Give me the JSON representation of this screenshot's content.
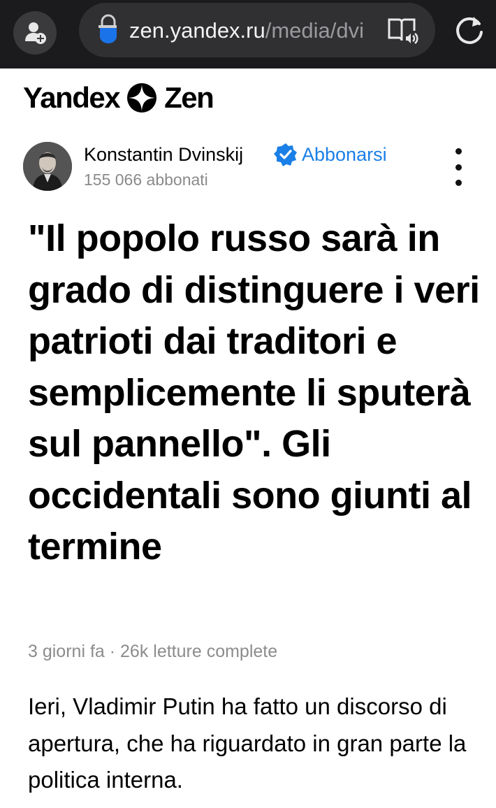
{
  "browser": {
    "url_domain": "zen.yandex.ru",
    "url_path": "/media/dvi",
    "colors": {
      "bar": "#1b1b1d",
      "pill": "#303033",
      "lock_blue": "#1a73e8"
    },
    "icons": [
      "incognito-add-icon",
      "lock-icon",
      "reader-mode-icon",
      "reload-icon"
    ]
  },
  "logo": {
    "left": "Yandex",
    "right": "Zen"
  },
  "author": {
    "name": "Konstantin Dvinskij",
    "subscribe_label": "Abbonarsi",
    "subscribers": "155 066 abbonati",
    "colors": {
      "link": "#1a7fe6",
      "verified": "#1a7fe6"
    }
  },
  "article": {
    "title": "\"Il popolo russo sarà in grado di distinguere i veri patrioti dai traditori e semplicemente li sputerà sul pannello\". Gli occidentali sono giunti al termine",
    "meta": "3 giorni fa · 26k letture complete",
    "body": "Ieri, Vladimir Putin ha fatto un discorso di apertura, che ha riguardato in gran parte la politica interna."
  }
}
